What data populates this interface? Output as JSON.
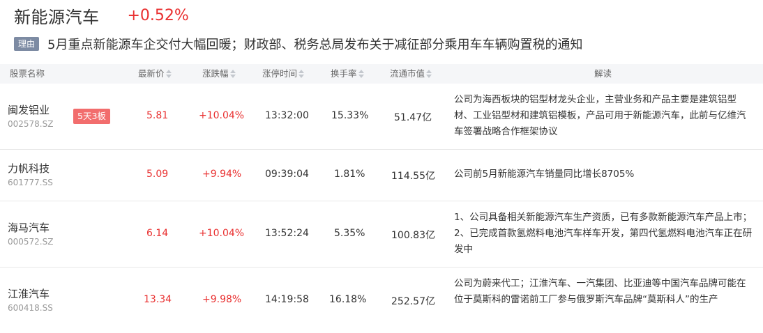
{
  "sector": {
    "name": "新能源汽车",
    "change": "+0.52%"
  },
  "reason": {
    "tag": "理由",
    "text": "5月重点新能源车企交付大幅回暖；财政部、税务总局发布关于减征部分乘用车车辆购置税的通知"
  },
  "columns": {
    "name": "股票名称",
    "price": "最新价",
    "change": "涨跌幅",
    "limit_time": "涨停时间",
    "turnover": "换手率",
    "market_cap": "流通市值",
    "interpretation": "解读"
  },
  "rows": [
    {
      "name": "闽发铝业",
      "code": "002578.SZ",
      "tag": "5天3板",
      "price": "5.81",
      "change": "+10.04%",
      "limit_time": "13:32:00",
      "turnover": "15.33%",
      "market_cap": "51.47亿",
      "interpretation": "公司为海西板块的铝型材龙头企业，主营业务和产品主要是建筑铝型材、工业铝型材和建筑铝模板，产品可用于新能源汽车，此前与亿维汽车签署战略合作框架协议"
    },
    {
      "name": "力帆科技",
      "code": "601777.SS",
      "tag": "",
      "price": "5.09",
      "change": "+9.94%",
      "limit_time": "09:39:04",
      "turnover": "1.81%",
      "market_cap": "114.55亿",
      "interpretation": "公司前5月新能源汽车销量同比增长8705%"
    },
    {
      "name": "海马汽车",
      "code": "000572.SZ",
      "tag": "",
      "price": "6.14",
      "change": "+10.04%",
      "limit_time": "13:52:24",
      "turnover": "5.35%",
      "market_cap": "100.83亿",
      "interpretation": "1、公司具备相关新能源汽车生产资质，已有多款新能源汽车产品上市； 2、已完成首款氢燃料电池汽车样车开发，第四代氢燃料电池汽车正在研发中"
    },
    {
      "name": "江淮汽车",
      "code": "600418.SS",
      "tag": "",
      "price": "13.34",
      "change": "+9.98%",
      "limit_time": "14:19:58",
      "turnover": "16.18%",
      "market_cap": "252.57亿",
      "interpretation": "公司为蔚来代工；江淮汽车、一汽集团、比亚迪等中国汽车品牌可能在位于莫斯科的雷诺前工厂参与俄罗斯汽车品牌“莫斯科人”的生产"
    }
  ]
}
